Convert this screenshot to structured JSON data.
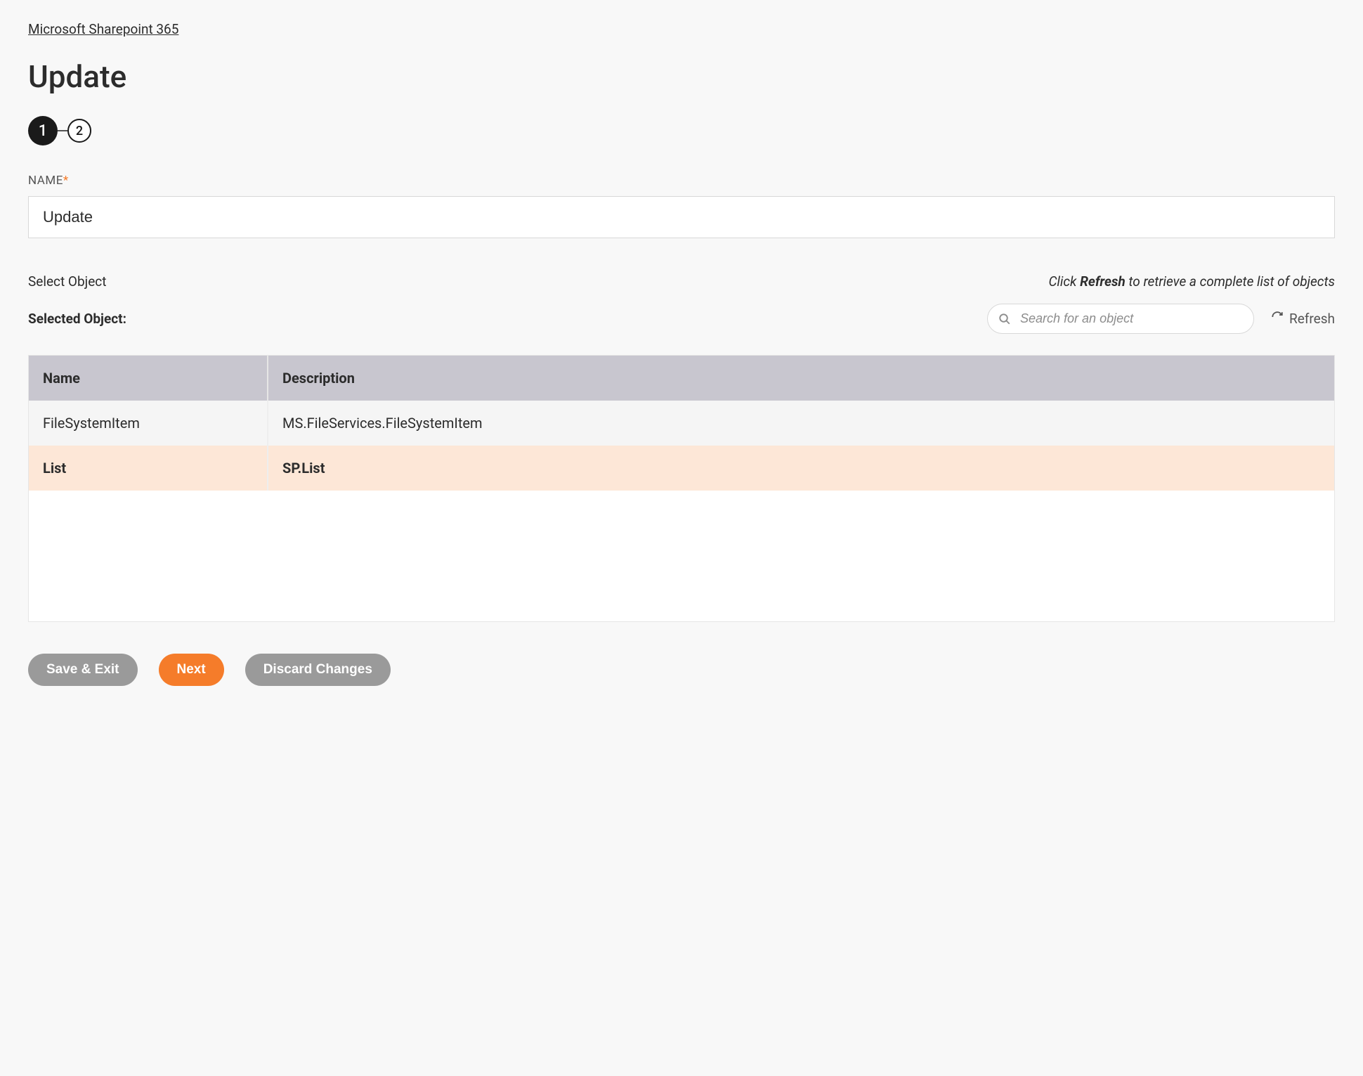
{
  "breadcrumb": {
    "link": "Microsoft Sharepoint 365"
  },
  "page": {
    "title": "Update"
  },
  "stepper": {
    "step1": "1",
    "step2": "2"
  },
  "nameField": {
    "label": "NAME",
    "value": "Update"
  },
  "selectObject": {
    "label": "Select Object",
    "hintPrefix": "Click ",
    "hintBold": "Refresh",
    "hintSuffix": " to retrieve a complete list of objects",
    "selectedLabel": "Selected Object:",
    "searchPlaceholder": "Search for an object",
    "refreshLabel": "Refresh"
  },
  "table": {
    "headers": {
      "name": "Name",
      "description": "Description"
    },
    "rows": [
      {
        "name": "FileSystemItem",
        "description": "MS.FileServices.FileSystemItem",
        "selected": false
      },
      {
        "name": "List",
        "description": "SP.List",
        "selected": true
      }
    ]
  },
  "buttons": {
    "saveExit": "Save & Exit",
    "next": "Next",
    "discard": "Discard Changes"
  }
}
